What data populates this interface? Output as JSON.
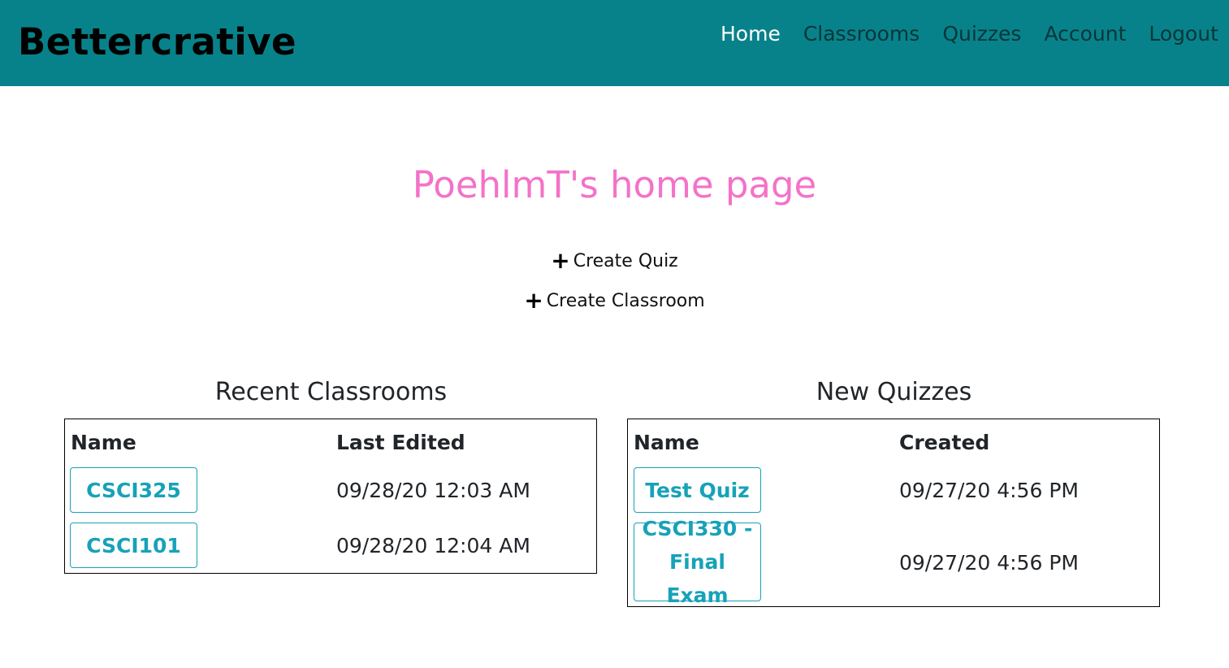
{
  "brand": "Bettercrative",
  "nav": {
    "home": "Home",
    "classrooms": "Classrooms",
    "quizzes": "Quizzes",
    "account": "Account",
    "logout": "Logout"
  },
  "page_title": "PoehlmT's home page",
  "actions": {
    "plus_icon": "+",
    "create_quiz": "Create Quiz",
    "create_classroom": "Create Classroom"
  },
  "recent_classrooms": {
    "title": "Recent Classrooms",
    "col_name": "Name",
    "col_date": "Last Edited",
    "rows": [
      {
        "name": "CSCI325",
        "date": "09/28/20 12:03 AM"
      },
      {
        "name": "CSCI101",
        "date": "09/28/20 12:04 AM"
      }
    ]
  },
  "new_quizzes": {
    "title": "New Quizzes",
    "col_name": "Name",
    "col_date": "Created",
    "rows": [
      {
        "name": "Test Quiz",
        "date": "09/27/20 4:56 PM"
      },
      {
        "name": "CSCI330 - Final Exam",
        "date": "09/27/20 4:56 PM"
      }
    ]
  },
  "colors": {
    "navbar": "#08828a",
    "title": "#f472c8",
    "accent": "#17a2b8"
  }
}
